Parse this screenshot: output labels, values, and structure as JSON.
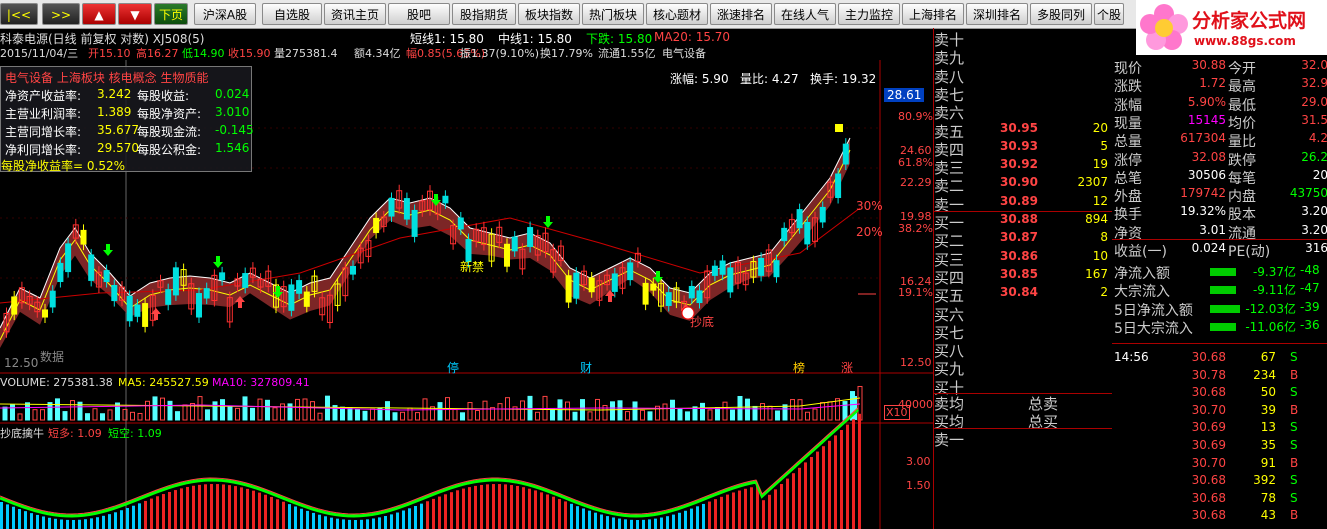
{
  "toolbar": {
    "buttons": [
      "|<<",
      ">>",
      "▲",
      "▼",
      "下页",
      "沪深A股",
      "自选股",
      "资讯主页",
      "股吧",
      "股指期货",
      "板块指数",
      "热门板块",
      "核心题材",
      "涨速排名",
      "在线人气",
      "主力监控",
      "上海排名",
      "深圳排名",
      "多股同列",
      "个股"
    ]
  },
  "logo": {
    "name": "分析家公式网",
    "url": "www.88gs.com"
  },
  "header": {
    "title": "科泰电源(日线 前复权 对数) XJ508(5)",
    "date": "2015/11/04/三",
    "open": "开15.10",
    "high": "高16.27",
    "low": "低14.90",
    "close": "收15.90",
    "volume": "量275381.4",
    "amount": "额4.34亿",
    "amp": "幅0.85(5.65%)",
    "short_line": "短线1: 15.80",
    "mid_line": "中线1: 15.80",
    "down": "下跌: 15.80",
    "ma20": "MA20: 15.70",
    "zhen": "振1.37(9.10%)",
    "huan": "换17.79%",
    "liutong": "流通1.55亿",
    "sector": "电气设备",
    "zhangfu": "涨幅: 5.90",
    "liangbi": "量比: 4.27",
    "huanshou": "换手: 19.32",
    "price_tag": "28.61"
  },
  "infobox": {
    "title": "电气设备 上海板块 核电概念 生物质能",
    "rows": [
      {
        "l1": "净资产收益率:",
        "v1": "3.242",
        "l2": "每股收益:",
        "v2": "0.024"
      },
      {
        "l1": "主营业利润率:",
        "v1": "1.389",
        "l2": "每股净资产:",
        "v2": "3.010"
      },
      {
        "l1": "主营同增长率:",
        "v1": "35.677",
        "l2": "每股现金流:",
        "v2": "-0.145"
      },
      {
        "l1": "净利同增长率:",
        "v1": "29.570",
        "l2": "每股公积金:",
        "v2": "1.546"
      }
    ],
    "footer": "每股净收益率= 0.52%"
  },
  "price_axis": [
    "80.9%",
    "24.60",
    "61.8%",
    "22.29",
    "19.98",
    "38.2%",
    "16.24",
    "19.1%",
    "12.50"
  ],
  "pct_labels": [
    "30%",
    "20%"
  ],
  "chart_texts": {
    "bottom_left": "12.50",
    "data_note": "数据",
    "jinjin": "新禁",
    "chaodi": "抄底",
    "tags": [
      "停",
      "财",
      "榜",
      "涨"
    ]
  },
  "volume": {
    "label": "VOLUME: 275381.38",
    "ma5": "MA5: 245527.59",
    "ma10": "MA10: 327809.41",
    "axis": "40000",
    "unit": "X10"
  },
  "indicator": {
    "name": "抄底擒牛",
    "short_long": "短多: 1.09",
    "short_short": "短空: 1.09",
    "axis": [
      "3.00",
      "1.50"
    ]
  },
  "orderbook": {
    "sell": [
      {
        "label": "卖十",
        "price": "",
        "vol": ""
      },
      {
        "label": "卖九",
        "price": "",
        "vol": ""
      },
      {
        "label": "卖八",
        "price": "",
        "vol": ""
      },
      {
        "label": "卖七",
        "price": "",
        "vol": ""
      },
      {
        "label": "卖六",
        "price": "",
        "vol": ""
      },
      {
        "label": "卖五",
        "price": "30.95",
        "vol": "20"
      },
      {
        "label": "卖四",
        "price": "30.93",
        "vol": "5"
      },
      {
        "label": "卖三",
        "price": "30.92",
        "vol": "19"
      },
      {
        "label": "卖二",
        "price": "30.90",
        "vol": "2307"
      },
      {
        "label": "卖一",
        "price": "30.89",
        "vol": "12"
      }
    ],
    "buy": [
      {
        "label": "买一",
        "price": "30.88",
        "vol": "894"
      },
      {
        "label": "买二",
        "price": "30.87",
        "vol": "8"
      },
      {
        "label": "买三",
        "price": "30.86",
        "vol": "10"
      },
      {
        "label": "买四",
        "price": "30.85",
        "vol": "167"
      },
      {
        "label": "买五",
        "price": "30.84",
        "vol": "2"
      },
      {
        "label": "买六",
        "price": "",
        "vol": ""
      },
      {
        "label": "买七",
        "price": "",
        "vol": ""
      },
      {
        "label": "买八",
        "price": "",
        "vol": ""
      },
      {
        "label": "买九",
        "price": "",
        "vol": ""
      },
      {
        "label": "买十",
        "price": "",
        "vol": ""
      }
    ],
    "avg_sell_label": "卖均",
    "avg_buy_label": "买均",
    "total_sell": "总卖",
    "total_buy": "总买",
    "last_label": "卖一"
  },
  "quote": [
    {
      "l1": "现价",
      "v1": "30.88",
      "l2": "今开",
      "v2": "32.0"
    },
    {
      "l1": "涨跌",
      "v1": "1.72",
      "l2": "最高",
      "v2": "32.9"
    },
    {
      "l1": "涨幅",
      "v1": "5.90%",
      "l2": "最低",
      "v2": "29.0"
    },
    {
      "l1": "现量",
      "v1": "15145",
      "l2": "均价",
      "v2": "31.5"
    },
    {
      "l1": "总量",
      "v1": "617304",
      "l2": "量比",
      "v2": "4.2"
    },
    {
      "l1": "涨停",
      "v1": "32.08",
      "l2": "跌停",
      "v2": "26.2"
    },
    {
      "l1": "总笔",
      "v1": "30506",
      "l2": "每笔",
      "v2": "20"
    },
    {
      "l1": "外盘",
      "v1": "179742",
      "l2": "内盘",
      "v2": "43750"
    },
    {
      "l1": "换手",
      "v1": "19.32%",
      "l2": "股本",
      "v2": "3.20"
    },
    {
      "l1": "净资",
      "v1": "3.01",
      "l2": "流通",
      "v2": "3.20"
    },
    {
      "l1": "收益(一)",
      "v1": "0.024",
      "l2": "PE(动)",
      "v2": "316"
    }
  ],
  "flows": [
    {
      "label": "净流入额",
      "v1": "-9.37亿",
      "v2": "-48"
    },
    {
      "label": "大宗流入",
      "v1": "-9.11亿",
      "v2": "-47"
    },
    {
      "label": "5日净流入额",
      "v1": "-12.03亿",
      "v2": "-39"
    },
    {
      "label": "5日大宗流入",
      "v1": "-11.06亿",
      "v2": "-36"
    }
  ],
  "ticks": [
    {
      "time": "14:56",
      "price": "30.68",
      "vol": "67",
      "bs": "S"
    },
    {
      "time": "",
      "price": "30.78",
      "vol": "234",
      "bs": "B"
    },
    {
      "time": "",
      "price": "30.68",
      "vol": "50",
      "bs": "S"
    },
    {
      "time": "",
      "price": "30.70",
      "vol": "39",
      "bs": "B"
    },
    {
      "time": "",
      "price": "30.69",
      "vol": "13",
      "bs": "S"
    },
    {
      "time": "",
      "price": "30.69",
      "vol": "35",
      "bs": "S"
    },
    {
      "time": "",
      "price": "30.70",
      "vol": "91",
      "bs": "B"
    },
    {
      "time": "",
      "price": "30.68",
      "vol": "392",
      "bs": "S"
    },
    {
      "time": "",
      "price": "30.68",
      "vol": "78",
      "bs": "S"
    },
    {
      "time": "",
      "price": "30.68",
      "vol": "43",
      "bs": "B"
    }
  ]
}
